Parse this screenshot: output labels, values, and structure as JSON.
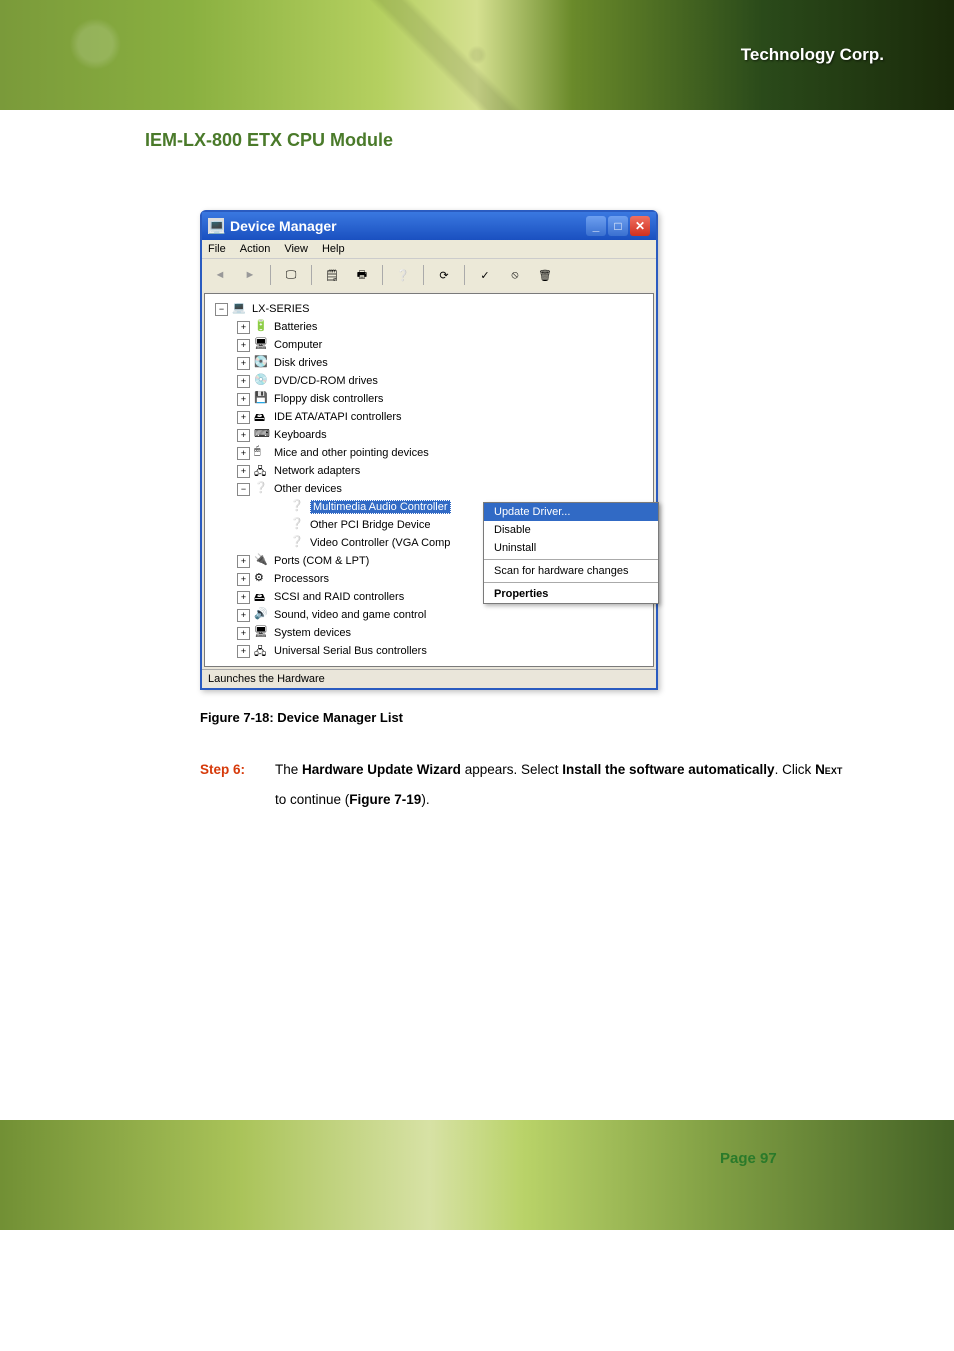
{
  "document": {
    "title": "IEM-LX-800 ETX CPU Module",
    "brand": "Technology Corp.",
    "page_label": "Page 97"
  },
  "window": {
    "title": "Device Manager",
    "menus": [
      "File",
      "Action",
      "View",
      "Help"
    ],
    "root": "LX-SERIES",
    "nodes": [
      "Batteries",
      "Computer",
      "Disk drives",
      "DVD/CD-ROM drives",
      "Floppy disk controllers",
      "IDE ATA/ATAPI controllers",
      "Keyboards",
      "Mice and other pointing devices",
      "Network adapters"
    ],
    "other_devices_label": "Other devices",
    "other_devices_children": [
      "Multimedia Audio Controller",
      "Other PCI Bridge Device",
      "Video Controller (VGA Comp"
    ],
    "nodes_after": [
      "Ports (COM & LPT)",
      "Processors",
      "SCSI and RAID controllers",
      "Sound, video and game control",
      "System devices",
      "Universal Serial Bus controllers"
    ],
    "context_menu": {
      "update": "Update Driver...",
      "disable": "Disable",
      "uninstall": "Uninstall",
      "scan": "Scan for hardware changes",
      "properties": "Properties"
    },
    "status": "Launches the Hardware"
  },
  "caption": "Figure 7-18: Device Manager List",
  "step": {
    "label": "Step 6:",
    "text_before": "The ",
    "b1": "Hardware Update Wizard",
    "mid1": " appears. Select ",
    "b2": "Install the software automatically",
    "mid2": ". Click ",
    "b3": "Next",
    "mid3": " to continue (",
    "b4": "Figure 7-19",
    "end": ")."
  }
}
